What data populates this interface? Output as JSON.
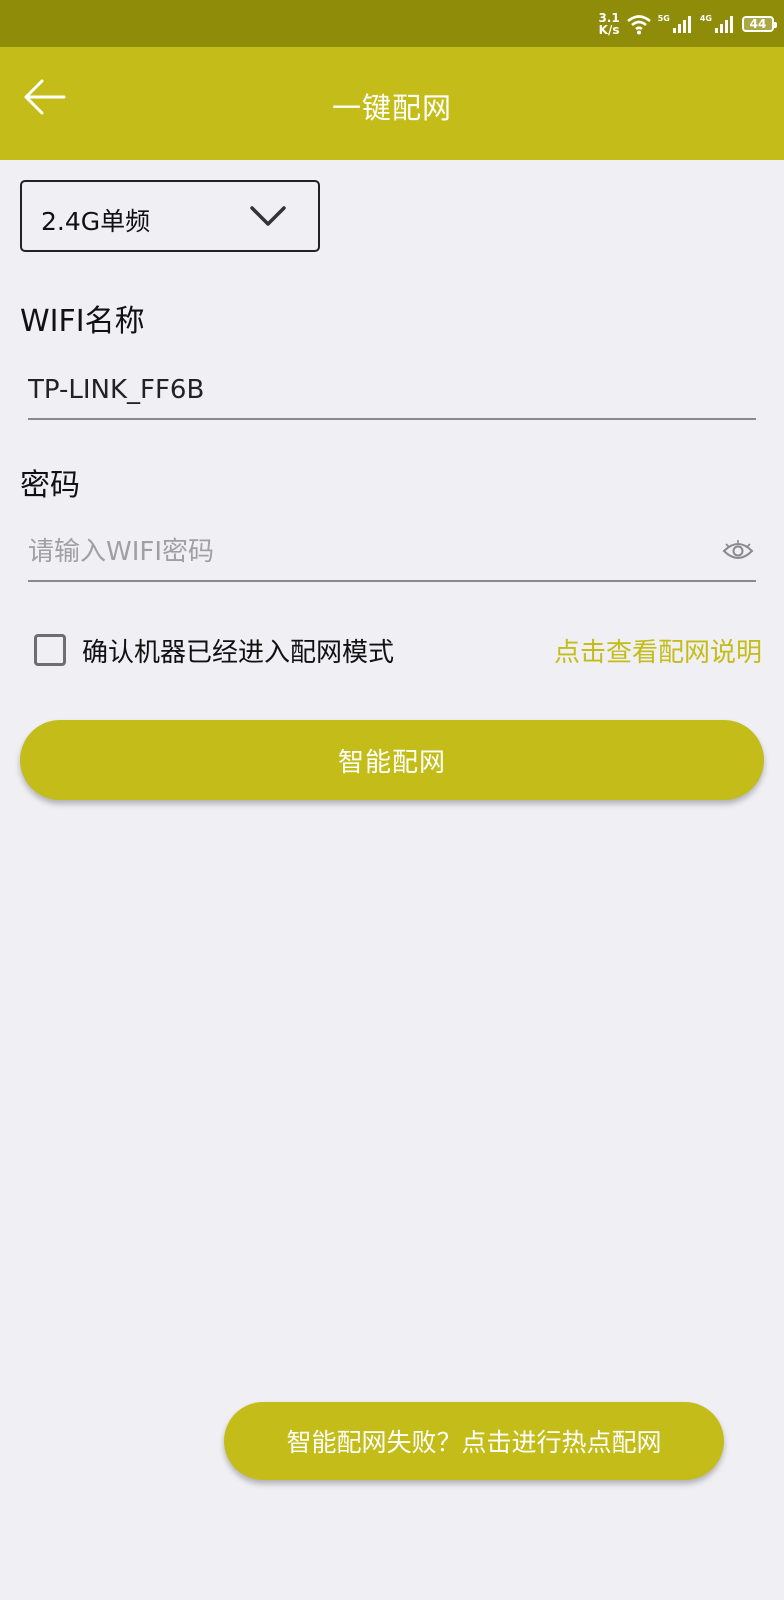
{
  "status_bar": {
    "net_speed_value": "3.1",
    "net_speed_unit": "K/s",
    "signal_1_label": "5G",
    "signal_2_label": "4G",
    "battery": "44"
  },
  "app_bar": {
    "title": "一键配网"
  },
  "band_select": {
    "value": "2.4G单频"
  },
  "wifi_name": {
    "label": "WIFI名称",
    "value": "TP-LINK_FF6B"
  },
  "password": {
    "label": "密码",
    "placeholder": "请输入WIFI密码"
  },
  "confirm": {
    "text": "确认机器已经进入配网模式",
    "checked": false
  },
  "help_link": "点击查看配网说明",
  "smart_button": "智能配网",
  "hotspot_button": "智能配网失败？点击进行热点配网",
  "colors": {
    "accent": "#c4bd19",
    "status_bar": "#8f8c0a",
    "background": "#efeff4"
  }
}
